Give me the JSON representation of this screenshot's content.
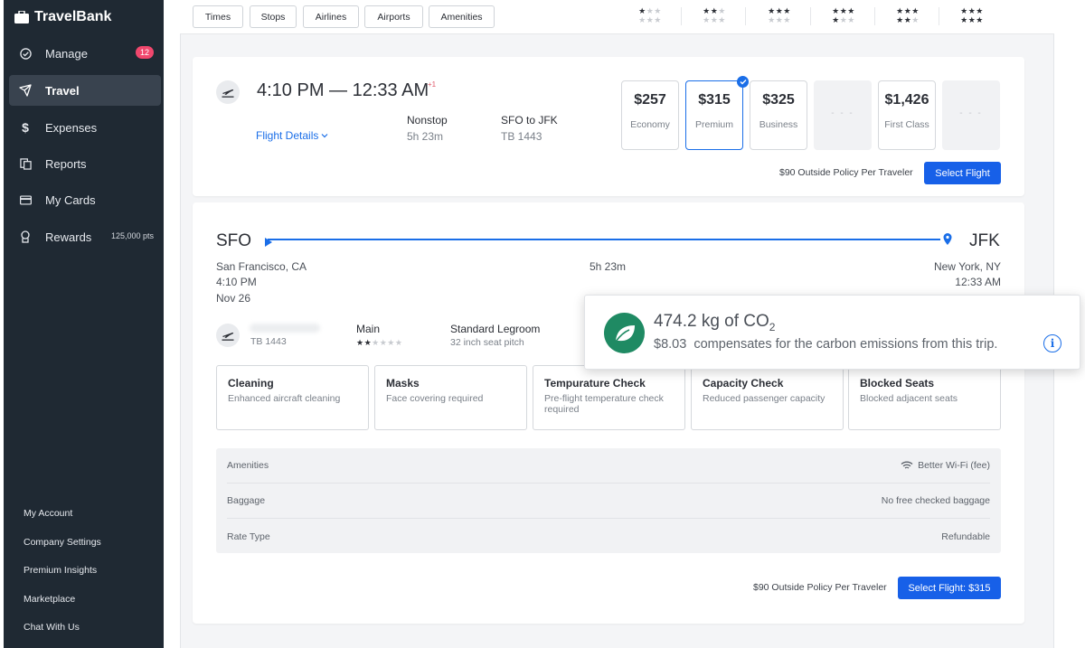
{
  "app": {
    "name": "TravelBank"
  },
  "sidebar": {
    "items": [
      {
        "label": "Manage",
        "icon": "check-circle-icon",
        "badge": "12"
      },
      {
        "label": "Travel",
        "icon": "plane-icon",
        "active": true
      },
      {
        "label": "Expenses",
        "icon": "dollar-icon"
      },
      {
        "label": "Reports",
        "icon": "reports-icon"
      },
      {
        "label": "My Cards",
        "icon": "card-icon"
      },
      {
        "label": "Rewards",
        "icon": "rewards-icon",
        "points": "125,000 pts"
      }
    ],
    "bottom_links": [
      "My Account",
      "Company Settings",
      "Premium Insights",
      "Marketplace",
      "Chat With Us"
    ]
  },
  "filters": [
    "Times",
    "Stops",
    "Airlines",
    "Airports",
    "Amenities"
  ],
  "flight": {
    "times": "4:10 PM — 12:33 AM",
    "day_offset": "+1",
    "details_link": "Flight Details",
    "stops": "Nonstop",
    "duration": "5h 23m",
    "route": "SFO to JFK",
    "flight_number": "TB 1443",
    "fares": [
      {
        "price": "$257",
        "class": "Economy"
      },
      {
        "price": "$315",
        "class": "Premium",
        "selected": true
      },
      {
        "price": "$325",
        "class": "Business"
      },
      {
        "price": "- - -",
        "class": "",
        "empty": true
      },
      {
        "price": "$1,426",
        "class": "First Class"
      },
      {
        "price": "- - -",
        "class": "",
        "empty": true
      }
    ],
    "policy_note": "$90 Outside Policy Per Traveler",
    "select_label": "Select Flight"
  },
  "detail": {
    "origin_code": "SFO",
    "dest_code": "JFK",
    "origin_city": "San Francisco, CA",
    "dest_city": "New York, NY",
    "depart_time": "4:10 PM",
    "arrive_time": "12:33 AM",
    "date": "Nov 26",
    "duration": "5h 23m",
    "flight_number": "TB 1443",
    "cabin": "Main",
    "legroom_title": "Standard Legroom",
    "legroom_detail": "32 inch seat pitch",
    "safety": [
      {
        "title": "Cleaning",
        "desc": "Enhanced aircraft cleaning"
      },
      {
        "title": "Masks",
        "desc": "Face covering required"
      },
      {
        "title": "Tempurature Check",
        "desc": "Pre-flight temperature check required"
      },
      {
        "title": "Capacity Check",
        "desc": "Reduced passenger capacity"
      },
      {
        "title": "Blocked Seats",
        "desc": "Blocked adjacent seats"
      }
    ],
    "rows": [
      {
        "label": "Amenities",
        "value": "Better Wi-Fi (fee)"
      },
      {
        "label": "Baggage",
        "value": "No free checked baggage"
      },
      {
        "label": "Rate Type",
        "value": "Refundable"
      }
    ],
    "policy_note": "$90 Outside Policy Per Traveler",
    "select_label": "Select Flight: $315"
  },
  "co2": {
    "amount": "474.2 kg of CO",
    "subscript": "2",
    "price": "$8.03",
    "text": "compensates for the carbon emissions from this trip."
  },
  "colors": {
    "sidebar": "#1f2933",
    "accent": "#1760e8",
    "badge": "#f0476d",
    "leaf": "#1f8a63"
  }
}
